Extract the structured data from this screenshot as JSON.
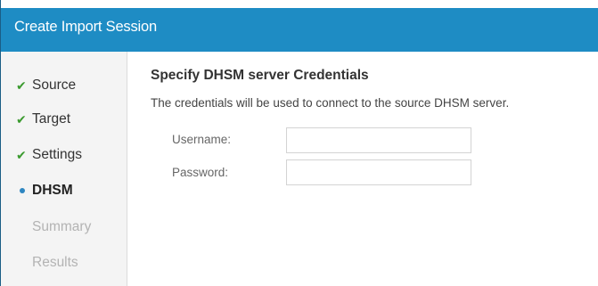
{
  "dialog": {
    "title": "Create Import Session"
  },
  "sidebar": {
    "steps": [
      {
        "label": "Source",
        "state": "done",
        "icon": "checkmark-icon"
      },
      {
        "label": "Target",
        "state": "done",
        "icon": "checkmark-icon"
      },
      {
        "label": "Settings",
        "state": "done",
        "icon": "checkmark-icon"
      },
      {
        "label": "DHSM",
        "state": "active",
        "icon": "current-step-dot-icon"
      },
      {
        "label": "Summary",
        "state": "pending"
      },
      {
        "label": "Results",
        "state": "pending"
      }
    ]
  },
  "main": {
    "heading": "Specify DHSM server Credentials",
    "description": "The credentials will be used to connect to the source DHSM server.",
    "username": {
      "label": "Username:",
      "value": ""
    },
    "password": {
      "label": "Password:",
      "value": ""
    }
  },
  "colors": {
    "titlebar": "#1e8cc4",
    "check": "#3a9a2e",
    "active_dot": "#2e86c1",
    "pending_text": "#b3b3b3"
  }
}
